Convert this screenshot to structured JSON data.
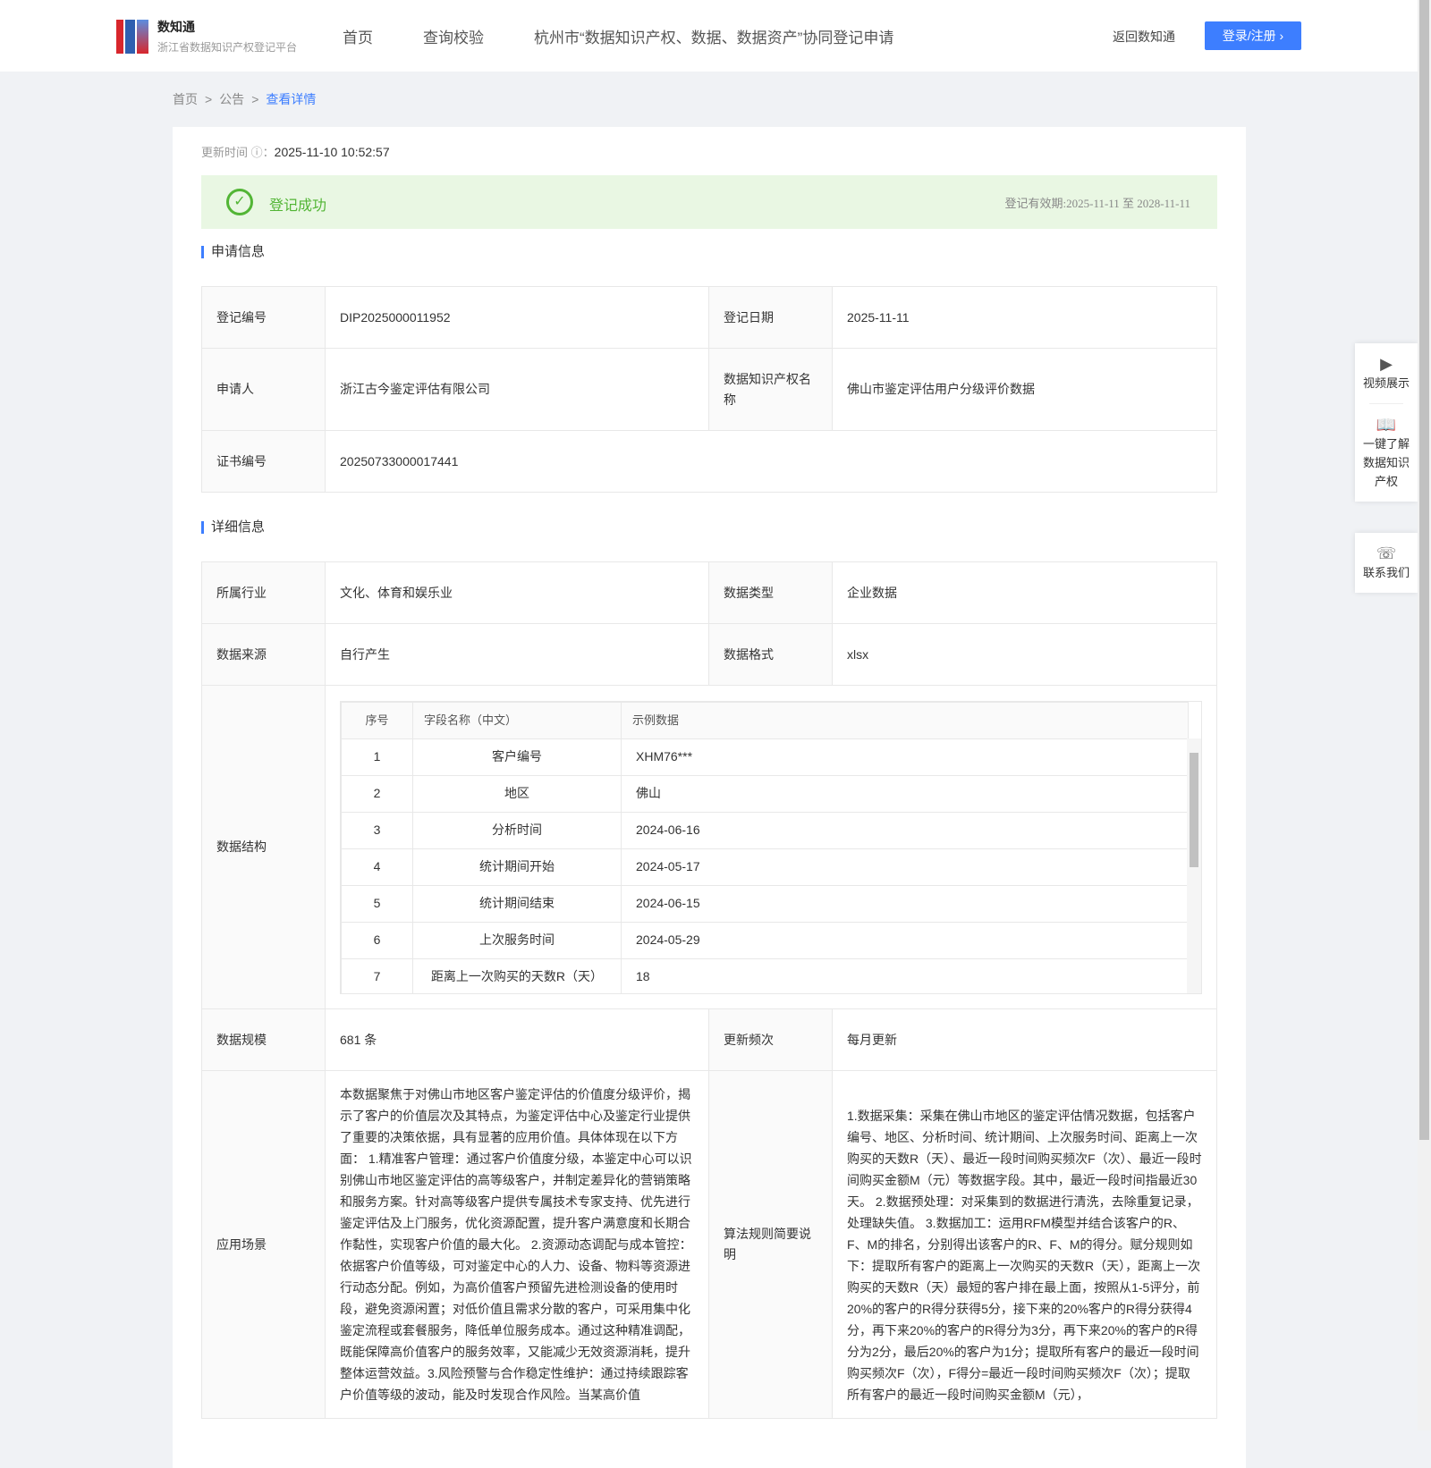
{
  "header": {
    "logo_title": "数知通",
    "logo_subtitle": "浙江省数据知识产权登记平台",
    "nav": [
      "首页",
      "查询校验",
      "杭州市“数据知识产权、数据、数据资产”协同登记申请"
    ],
    "back": "返回数知通",
    "login": "登录/注册 ›"
  },
  "breadcrumb": {
    "items": [
      "首页",
      "公告"
    ],
    "current": "查看详情",
    "sep": ">"
  },
  "update": {
    "label": "更新时间",
    "value": "2025-11-10 10:52:57"
  },
  "status": {
    "label": "登记成功",
    "validity_label": "登记有效期:",
    "validity": "2025-11-11 至 2028-11-11",
    "color": "#52b535"
  },
  "apply": {
    "title": "申请信息",
    "reg_no_label": "登记编号",
    "reg_no": "DIP2025000011952",
    "reg_date_label": "登记日期",
    "reg_date": "2025-11-11",
    "applicant_label": "申请人",
    "applicant": "浙江古今鉴定评估有限公司",
    "name_label": "数据知识产权名称",
    "name": "佛山市鉴定评估用户分级评价数据",
    "cert_label": "证书编号",
    "cert": "20250733000017441"
  },
  "detail": {
    "title": "详细信息",
    "industry_label": "所属行业",
    "industry": "文化、体育和娱乐业",
    "type_label": "数据类型",
    "type": "企业数据",
    "source_label": "数据来源",
    "source": "自行产生",
    "format_label": "数据格式",
    "format": "xlsx",
    "structure_label": "数据结构",
    "structure": {
      "headers": [
        "序号",
        "字段名称（中文）",
        "示例数据"
      ],
      "rows": [
        [
          "1",
          "客户编号",
          "XHM76***"
        ],
        [
          "2",
          "地区",
          "佛山"
        ],
        [
          "3",
          "分析时间",
          "2024-06-16"
        ],
        [
          "4",
          "统计期间开始",
          "2024-05-17"
        ],
        [
          "5",
          "统计期间结束",
          "2024-06-15"
        ],
        [
          "6",
          "上次服务时间",
          "2024-05-29"
        ],
        [
          "7",
          "距离上一次购买的天数R（天）",
          "18"
        ]
      ]
    },
    "scale_label": "数据规模",
    "scale": "681 条",
    "freq_label": "更新频次",
    "freq": "每月更新",
    "scene_label": "应用场景",
    "scene": "本数据聚焦于对佛山市地区客户鉴定评估的价值度分级评价，揭示了客户的价值层次及其特点，为鉴定评估中心及鉴定行业提供了重要的决策依据，具有显著的应用价值。具体体现在以下方面： 1.精准客户管理：通过客户价值度分级，本鉴定中心可以识别佛山市地区鉴定评估的高等级客户，并制定差异化的营销策略和服务方案。针对高等级客户提供专属技术专家支持、优先进行鉴定评估及上门服务，优化资源配置，提升客户满意度和长期合作黏性，实现客户价值的最大化。 2.资源动态调配与成本管控：依据客户价值等级，可对鉴定中心的人力、设备、物料等资源进行动态分配。例如，为高价值客户预留先进检测设备的使用时段，避免资源闲置；对低价值且需求分散的客户，可采用集中化鉴定流程或套餐服务，降低单位服务成本。通过这种精准调配，既能保障高价值客户的服务效率，又能减少无效资源消耗，提升整体运营效益。3.风险预警与合作稳定性维护：通过持续跟踪客户价值等级的波动，能及时发现合作风险。当某高价值",
    "algo_label": "算法规则简要说明",
    "algo": "1.数据采集：采集在佛山市地区的鉴定评估情况数据，包括客户编号、地区、分析时间、统计期间、上次服务时间、距离上一次购买的天数R（天）、最近一段时间购买频次F（次）、最近一段时间购买金额M（元）等数据字段。其中，最近一段时间指最近30天。 2.数据预处理：对采集到的数据进行清洗，去除重复记录，处理缺失值。 3.数据加工：运用RFM模型并结合该客户的R、F、M的排名，分别得出该客户的R、F、M的得分。赋分规则如下：提取所有客户的距离上一次购买的天数R（天），距离上一次购买的天数R（天）最短的客户排在最上面，按照从1-5评分，前20%的客户的R得分获得5分，接下来的20%客户的R得分获得4分，再下来20%的客户的R得分为3分，再下来20%的客户的R得分为2分，最后20%的客户为1分；提取所有客户的最近一段时间购买频次F（次），F得分=最近一段时间购买频次F（次）；提取所有客户的最近一段时间购买金额M（元），"
  },
  "float": {
    "video": "视频展示",
    "learn": "一键了解数据知识产权",
    "contact": "联系我们"
  }
}
